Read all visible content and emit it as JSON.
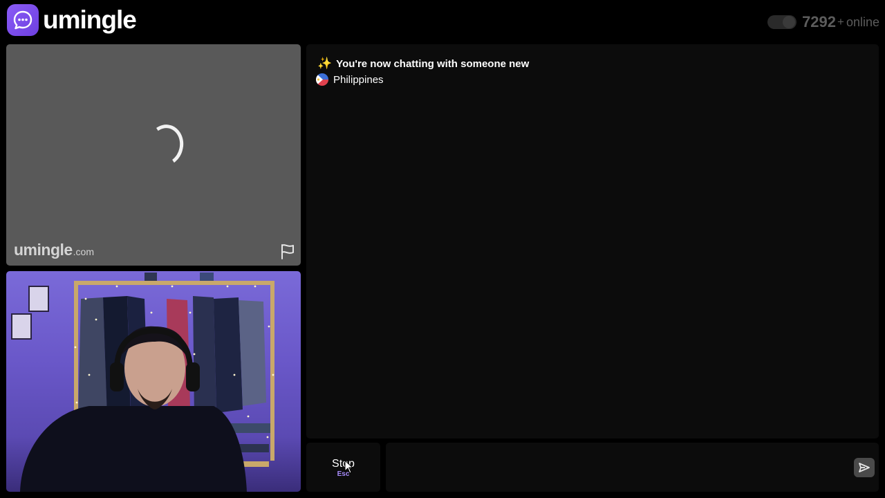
{
  "brand": {
    "name": "umingle",
    "icon": "chat-bubble-icon",
    "accent_color": "#8b5cf6"
  },
  "header": {
    "online_count": "7292",
    "online_plus": "+",
    "online_label": "online"
  },
  "remote_video": {
    "status": "loading",
    "watermark_main": "umingle",
    "watermark_tld": ".com",
    "report_icon": "flag-icon"
  },
  "chat": {
    "system_icon": "✨",
    "system_message": "You're now chatting with someone new",
    "partner_country": "Philippines"
  },
  "controls": {
    "stop_label": "Stop",
    "stop_shortcut": "Esc",
    "message_placeholder": "",
    "send_icon": "send-icon"
  }
}
